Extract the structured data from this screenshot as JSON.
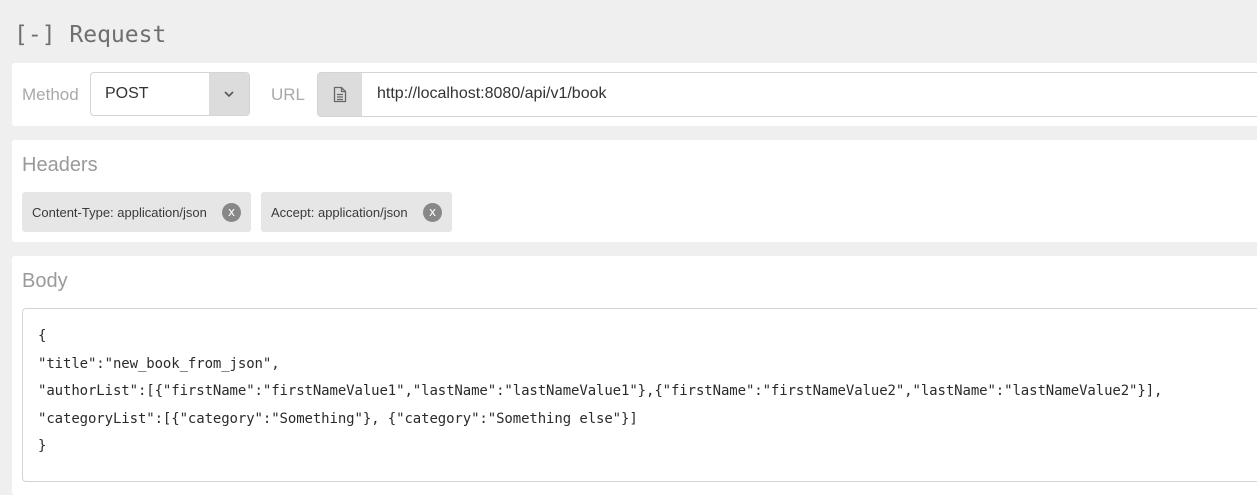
{
  "request": {
    "title": "[-] Request"
  },
  "method": {
    "label": "Method",
    "value": "POST",
    "caret_icon": "chevron-down-icon"
  },
  "url": {
    "label": "URL",
    "value": "http://localhost:8080/api/v1/book",
    "icon": "document-icon"
  },
  "headers": {
    "title": "Headers",
    "items": [
      {
        "text": "Content-Type: application/json",
        "remove": "x"
      },
      {
        "text": "Accept: application/json",
        "remove": "x"
      }
    ]
  },
  "body": {
    "title": "Body",
    "lines": [
      "{",
      "\"title\":\"new_book_from_json\",",
      "\"authorList\":[{\"firstName\":\"firstNameValue1\",\"lastName\":\"lastNameValue1\"},{\"firstName\":\"firstNameValue2\",\"lastName\":\"lastNameValue2\"}],",
      "\"categoryList\":[{\"category\":\"Something\"}, {\"category\":\"Something else\"}]",
      "}"
    ]
  },
  "colors": {
    "background": "#efefef",
    "panel": "#ffffff",
    "addon": "#dcdcdc",
    "chip": "#e6e6e6",
    "chip_remove": "#888888"
  }
}
